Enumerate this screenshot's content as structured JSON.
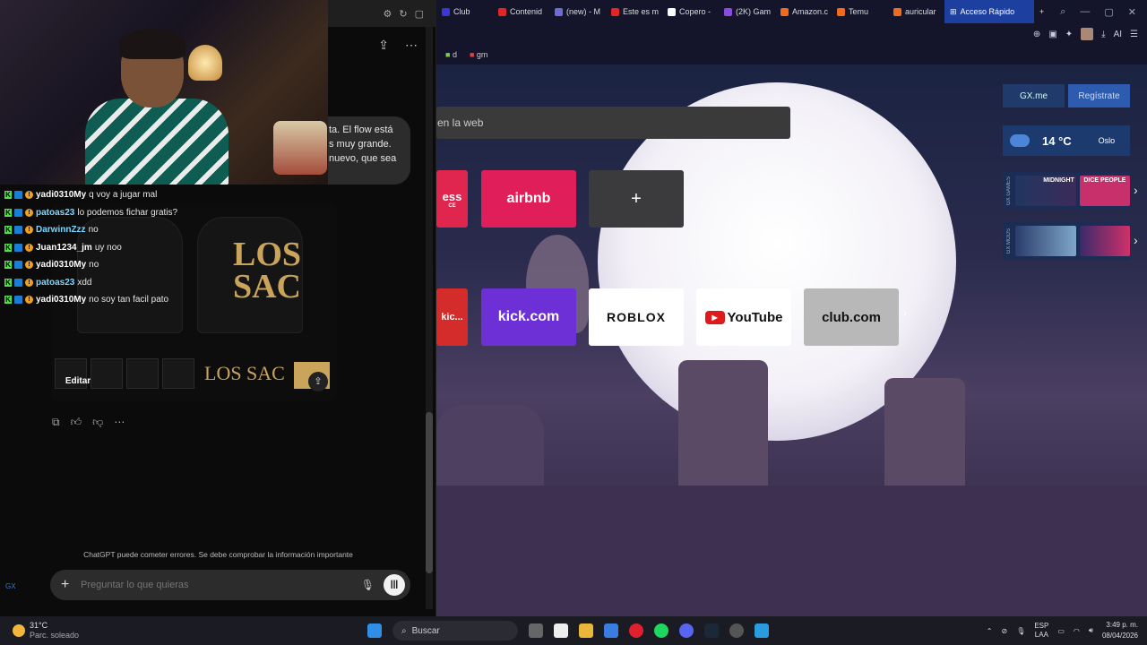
{
  "chat": {
    "bubble_text": "ta. El flow está\ns muy grande.\nnuevo, que sea",
    "edit_label": "Editar",
    "disclaimer": "ChatGPT puede cometer errores. Se debe comprobar la información importante",
    "composer_placeholder": "Preguntar lo que quieras",
    "jersey_text": "LOS\nSAC",
    "jersey_small": "LOS SAC",
    "gx_label": "GX"
  },
  "overlay_chat": [
    {
      "user": "yadi0310My",
      "msg": "q voy a jugar mal",
      "color": "#ffffff"
    },
    {
      "user": "patoas23",
      "msg": "lo podemos fichar gratis?",
      "color": "#7ad8ff"
    },
    {
      "user": "DarwinnZzz",
      "msg": "no",
      "color": "#7ad8ff"
    },
    {
      "user": "Juan1234_jm",
      "msg": "uy noo",
      "color": "#ffffff"
    },
    {
      "user": "yadi0310My",
      "msg": "no",
      "color": "#ffffff"
    },
    {
      "user": "patoas23",
      "msg": "xdd",
      "color": "#7ad8ff"
    },
    {
      "user": "yadi0310My",
      "msg": "no soy tan facil pato",
      "color": "#ffffff"
    }
  ],
  "browser": {
    "tabs": [
      {
        "label": "Club",
        "color": "#3b37d6"
      },
      {
        "label": "Contenid",
        "color": "#e02626"
      },
      {
        "label": "(new) - M",
        "color": "#6e6ad6"
      },
      {
        "label": "Este es m",
        "color": "#e02626"
      },
      {
        "label": "Copero -",
        "color": "#ffffff"
      },
      {
        "label": "(2K) Gam",
        "color": "#8c4be0"
      },
      {
        "label": "Amazon.c",
        "color": "#f26a1b"
      },
      {
        "label": "Temu",
        "color": "#f26a1b"
      },
      {
        "label": "auricular",
        "color": "#f26a1b"
      }
    ],
    "active_tab": "Acceso Rápido",
    "new_tab": "+",
    "bookmarks": [
      {
        "label": "d",
        "color": "#7ad14a"
      },
      {
        "label": "gm",
        "color": "#e04040"
      }
    ],
    "search_placeholder": "en la web",
    "ai_label": "AI",
    "tiles_row1": [
      {
        "label": "ess",
        "sub": "CE",
        "bg": "#e0254f"
      },
      {
        "label": "airbnb",
        "bg": "#e01f5a"
      },
      {
        "label": "+",
        "bg": "#3b3b3e"
      }
    ],
    "tiles_row2": [
      {
        "label": "kic...",
        "bg": "#d42b2b"
      },
      {
        "label": "kick.com",
        "bg": "#6d2fd6"
      },
      {
        "label": "ROBLOX",
        "bg": "#ffffff"
      },
      {
        "label": "YouTube",
        "bg": "#ffffff"
      },
      {
        "label": "club.com",
        "bg": "#b8b8b8"
      }
    ],
    "gx_me": "GX.me",
    "register": "Regístrate",
    "temperature": "14 °C",
    "city": "Oslo",
    "gx_games_label": "GX GAMES",
    "gx_mods_label": "GX MODS",
    "game1": "MIDNIGHT",
    "game2": "DICE PEOPLE"
  },
  "taskbar": {
    "temp": "31°C",
    "condition": "Parc. soleado",
    "search": "Buscar",
    "lang": "ESP",
    "layout": "LAA",
    "time": "3:49 p. m.",
    "date": "08/04/2026"
  }
}
